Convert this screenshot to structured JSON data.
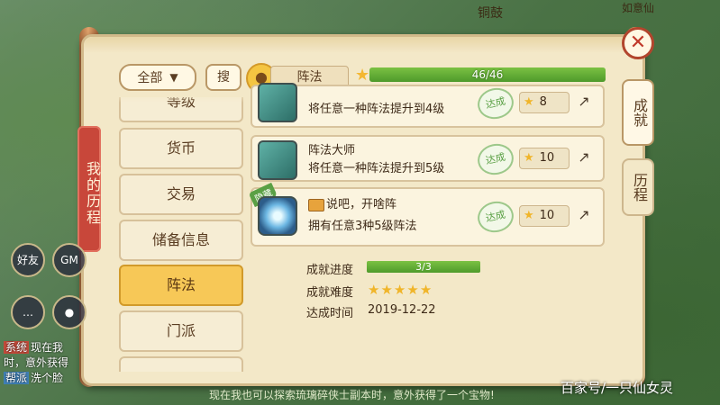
{
  "app": {
    "map_label": "铜鼓",
    "map_label2": "如意仙"
  },
  "header": {
    "filter_value": "全部",
    "search_label": "搜",
    "category_title": "阵法",
    "total_progress_text": "46/46",
    "total_progress_fraction": 1.0
  },
  "ribbon_title": "我的历程",
  "close_symbol": "✕",
  "sidebar": {
    "items": [
      {
        "label": "等级"
      },
      {
        "label": "货币"
      },
      {
        "label": "交易"
      },
      {
        "label": "储备信息"
      },
      {
        "label": "阵法",
        "active": true
      },
      {
        "label": "门派"
      }
    ]
  },
  "achievements": [
    {
      "name": "",
      "desc": "将任意一种阵法提升到4级",
      "status": "达成",
      "points": "8"
    },
    {
      "name": "阵法大师",
      "desc": "将任意一种阵法提升到5级",
      "status": "达成",
      "points": "10"
    },
    {
      "name": "说吧，开啥阵",
      "desc": "拥有任意3种5级阵法",
      "status": "达成",
      "points": "10",
      "tag": "隐藏"
    }
  ],
  "detail": {
    "progress_label": "成就进度",
    "progress_text": "3/3",
    "progress_fraction": 1.0,
    "difficulty_label": "成就难度",
    "difficulty_stars": 5,
    "time_label": "达成时间",
    "time_value": "2019-12-22"
  },
  "right_tabs": [
    {
      "label": "成就",
      "active": true
    },
    {
      "label": "历程",
      "active": false
    }
  ],
  "left_ui": {
    "friends_label": "好友",
    "gm_label": "GM",
    "chat_lines": [
      {
        "tag": "系统",
        "text": "现在我"
      },
      {
        "tag": "",
        "text": "时，意外获得"
      },
      {
        "tag": "帮派",
        "text": "洗个脸"
      }
    ]
  },
  "bottom_message": "现在我也可以探索琉璃碎侠士副本时，意外获得了一个宝物!",
  "watermark": "百家号/一只仙女灵",
  "colors": {
    "accent": "#f7c857",
    "progress": "#5aa830",
    "close": "#c0392b"
  }
}
